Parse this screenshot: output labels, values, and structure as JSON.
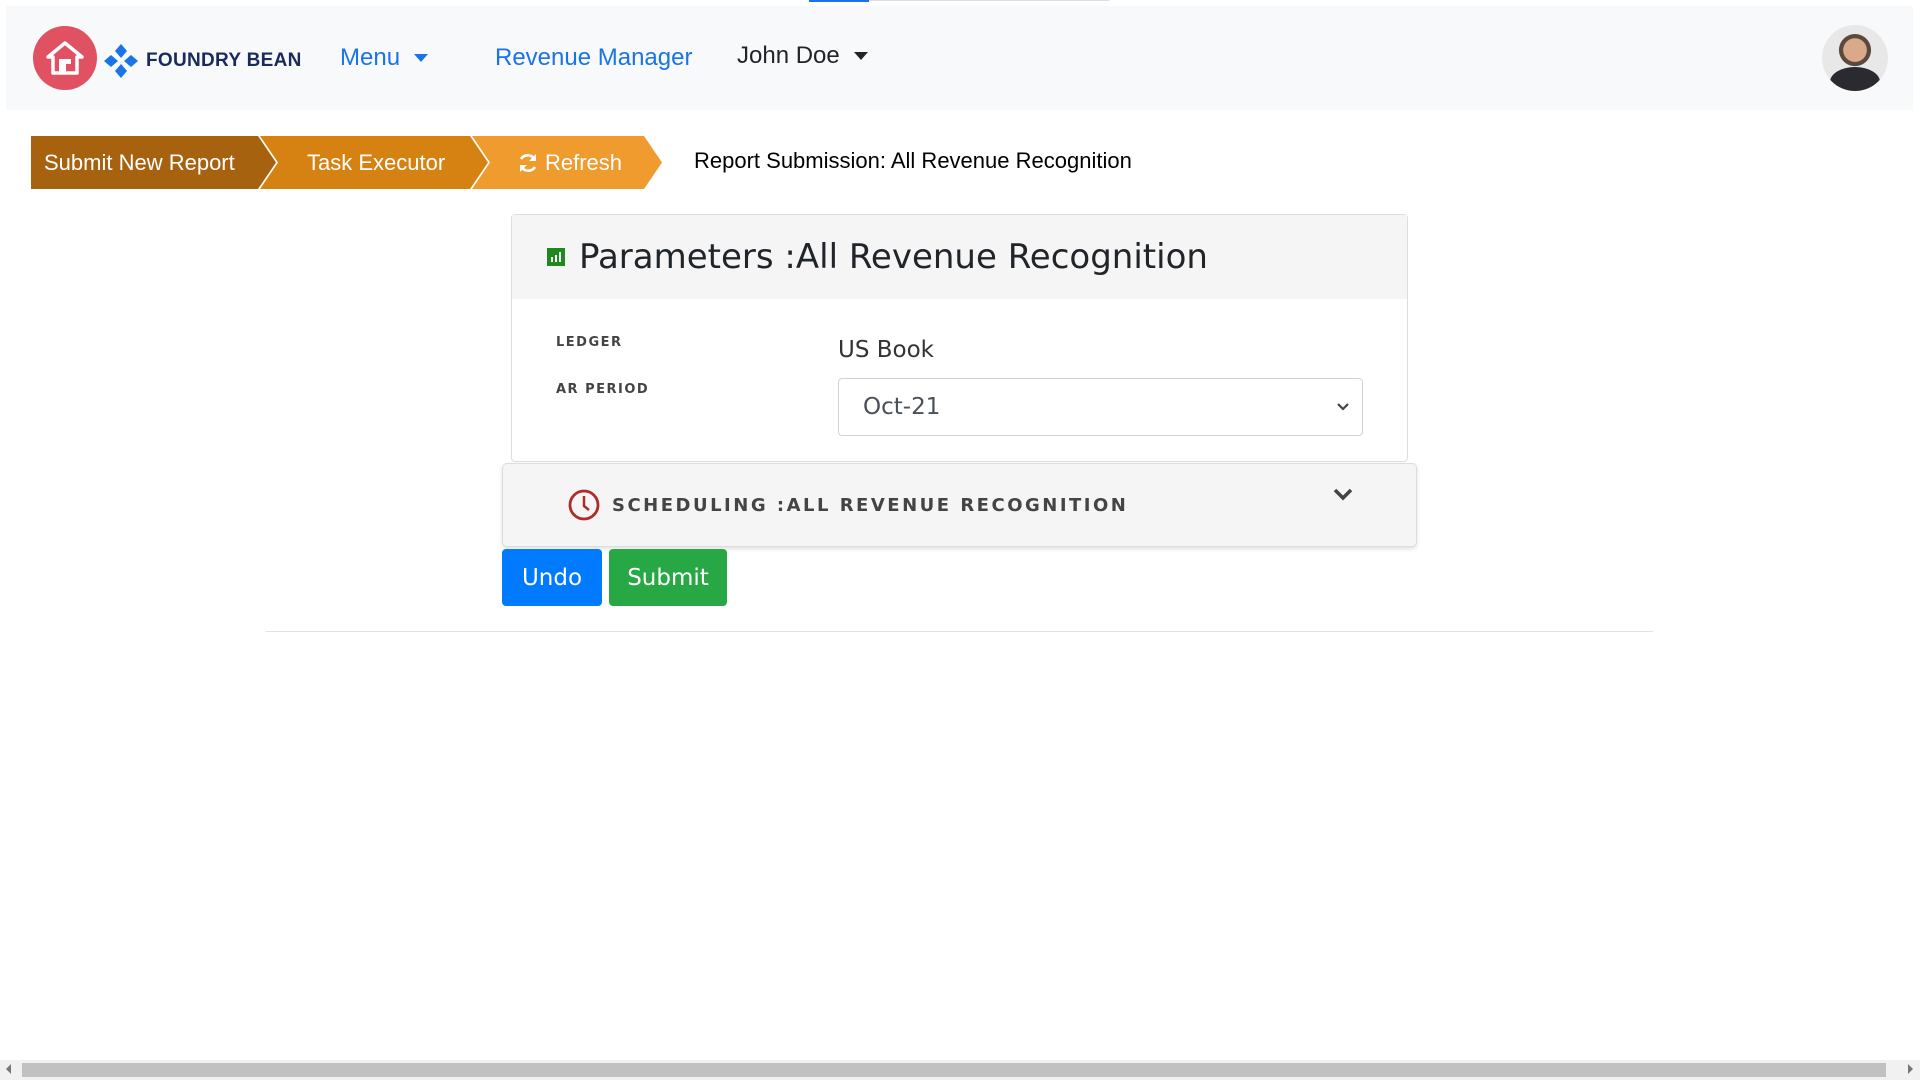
{
  "navbar": {
    "brand": "FOUNDRY BEAN",
    "menu_label": "Menu",
    "revenue_manager": "Revenue Manager",
    "user_name": "John Doe"
  },
  "breadcrumb": {
    "items": [
      "Submit New Report",
      "Task Executor",
      "Refresh"
    ],
    "title": "Report Submission: All Revenue Recognition"
  },
  "parameters": {
    "title": "Parameters :All Revenue Recognition",
    "ledger_label": "LEDGER",
    "ledger_value": "US Book",
    "ar_period_label": "AR PERIOD",
    "ar_period_value": "Oct-21"
  },
  "scheduling": {
    "title": "SCHEDULING :ALL REVENUE RECOGNITION"
  },
  "actions": {
    "undo": "Undo",
    "submit": "Submit"
  },
  "colors": {
    "primary": "#007bff",
    "success": "#28a745",
    "crumb1": "#a6620e",
    "crumb2": "#d58213",
    "crumb3": "#ef9b2e"
  }
}
